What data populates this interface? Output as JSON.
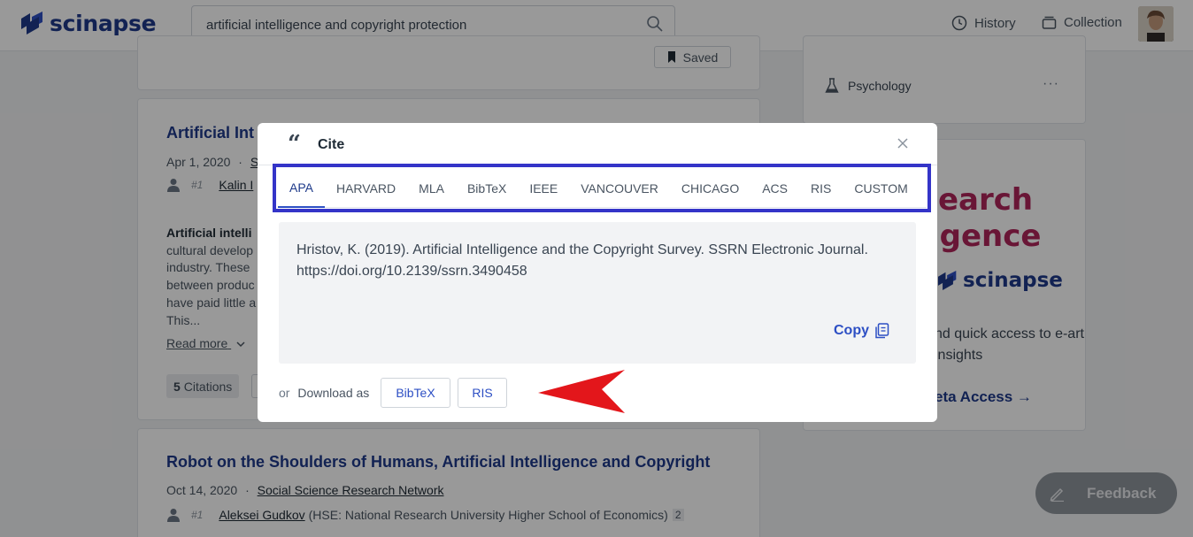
{
  "header": {
    "logo": "scinapse",
    "search_value": "artificial intelligence and copyright protection",
    "history_label": "History",
    "collection_label": "Collection"
  },
  "background": {
    "saved_label": "Saved",
    "paper1": {
      "title": "Artificial Int",
      "date": "Apr 1, 2020",
      "dot": "·",
      "journal_partial": "S",
      "rank": "#1",
      "author_partial": "Kalin I",
      "abstract_bold": "Artificial intelli",
      "abstract_lines": [
        "cultural develop",
        "industry. These",
        "between produc",
        "have paid little a",
        "This..."
      ],
      "read_more": "Read more",
      "citations_count": "5",
      "citations_label": "Citations"
    },
    "paper2": {
      "title": "Robot on the Shoulders of Humans, Artificial Intelligence and Copyright",
      "date": "Oct 14, 2020",
      "dot": "·",
      "journal": "Social Science Research Network",
      "rank": "#1",
      "author": "Aleksei Gudkov",
      "affiliation": "(HSE: National Research University Higher School of Economics)",
      "author_count": "2"
    }
  },
  "sidebar": {
    "field_label": "Psychology",
    "more": "···",
    "promo_line1": "earch",
    "promo_line2": "igence",
    "promo_logo": "scinapse",
    "promo_text": "nd quick access to e-art insights",
    "promo_link": "eta Access →"
  },
  "feedback_label": "Feedback",
  "modal": {
    "title": "Cite",
    "tabs": [
      "APA",
      "HARVARD",
      "MLA",
      "BibTeX",
      "IEEE",
      "VANCOUVER",
      "CHICAGO",
      "ACS",
      "RIS",
      "CUSTOM"
    ],
    "active_tab": "APA",
    "citation": "Hristov, K. (2019). Artificial Intelligence and the Copyright Survey. SSRN Electronic Journal. https://doi.org/10.2139/ssrn.3490458",
    "copy_label": "Copy",
    "download_or": "or",
    "download_label": "Download as",
    "download_bibtex": "BibTeX",
    "download_ris": "RIS"
  },
  "colors": {
    "brand": "#1e3a8a",
    "accent": "#2d4fc4",
    "highlight_frame": "#3434c8",
    "arrow": "#e3161b",
    "promo": "#b0265a"
  }
}
